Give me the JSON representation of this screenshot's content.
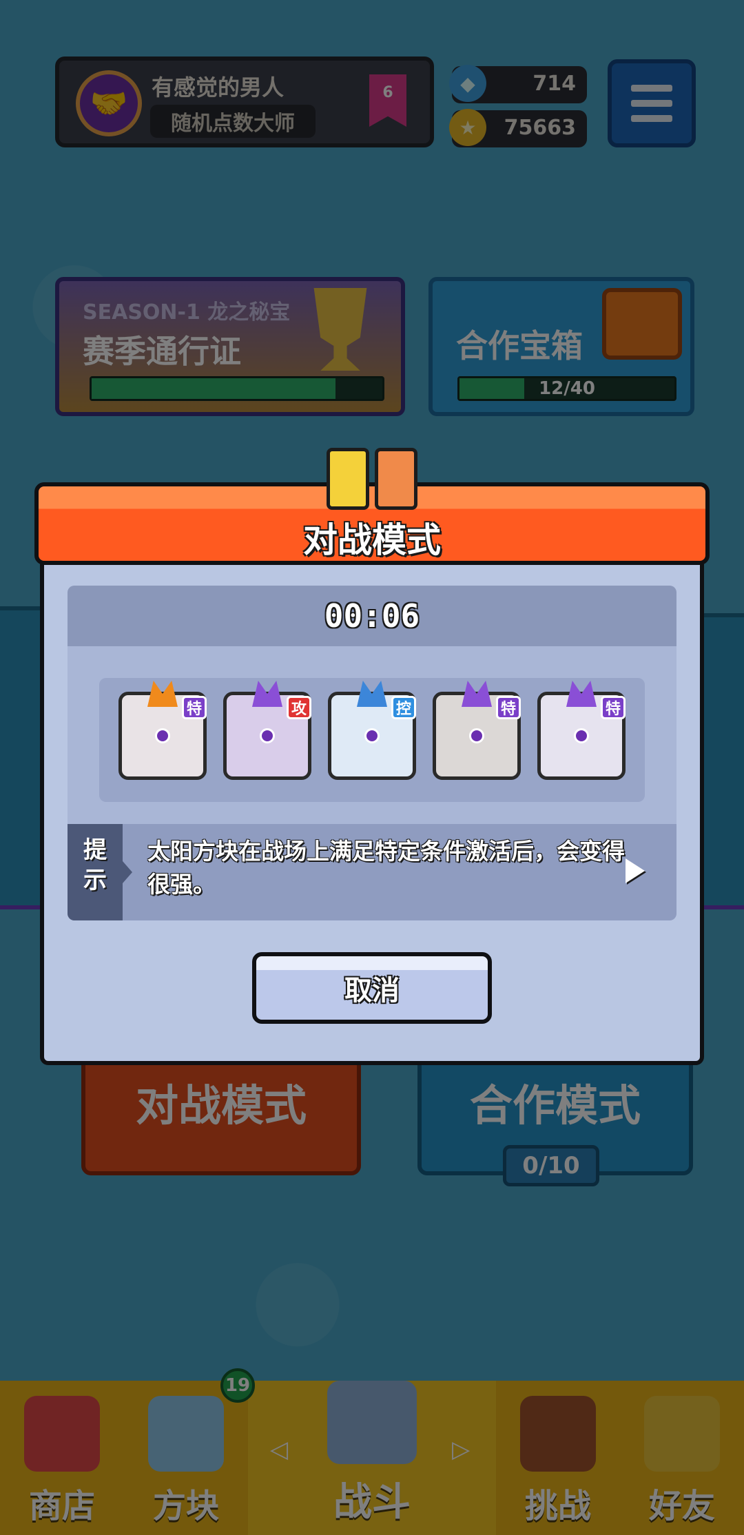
{
  "profile": {
    "name": "有感觉的男人",
    "title": "随机点数大师",
    "rank": "6"
  },
  "currency": {
    "gems": "714",
    "gold": "75663"
  },
  "season": {
    "label": "SEASON-1 龙之秘宝",
    "title": "赛季通行证",
    "progress": 0.84
  },
  "coop_chest": {
    "title": "合作宝箱",
    "count": "12/40",
    "progress": 0.3
  },
  "modes": {
    "battle": "对战模式",
    "coop": "合作模式",
    "coop_count": "0/10"
  },
  "dialog": {
    "title": "对战模式",
    "timer": "00:06",
    "dice": [
      {
        "name": "rainbow-die",
        "tag": "特",
        "tag_color": "#7a3fc8",
        "color": "#e9e3e6",
        "horn": "#f08a1c"
      },
      {
        "name": "nebula-die",
        "tag": "攻",
        "tag_color": "#e03434",
        "color": "#d9cdea",
        "horn": "#8a4fd6"
      },
      {
        "name": "ice-die",
        "tag": "控",
        "tag_color": "#2f8fe0",
        "color": "#dfeaf6",
        "horn": "#3c86d9"
      },
      {
        "name": "mist-die",
        "tag": "特",
        "tag_color": "#7a3fc8",
        "color": "#dcd8d6",
        "horn": "#8a4fd6"
      },
      {
        "name": "cycle-die",
        "tag": "特",
        "tag_color": "#7a3fc8",
        "color": "#e6e3ef",
        "horn": "#8a4fd6"
      }
    ],
    "tip_label": "提示",
    "tip_text": "太阳方块在战场上满足特定条件激活后，会变得很强。",
    "cancel": "取消"
  },
  "nav": {
    "shop": "商店",
    "dice": "方块",
    "dice_badge": "19",
    "battle": "战斗",
    "challenge": "挑战",
    "friends": "好友"
  }
}
